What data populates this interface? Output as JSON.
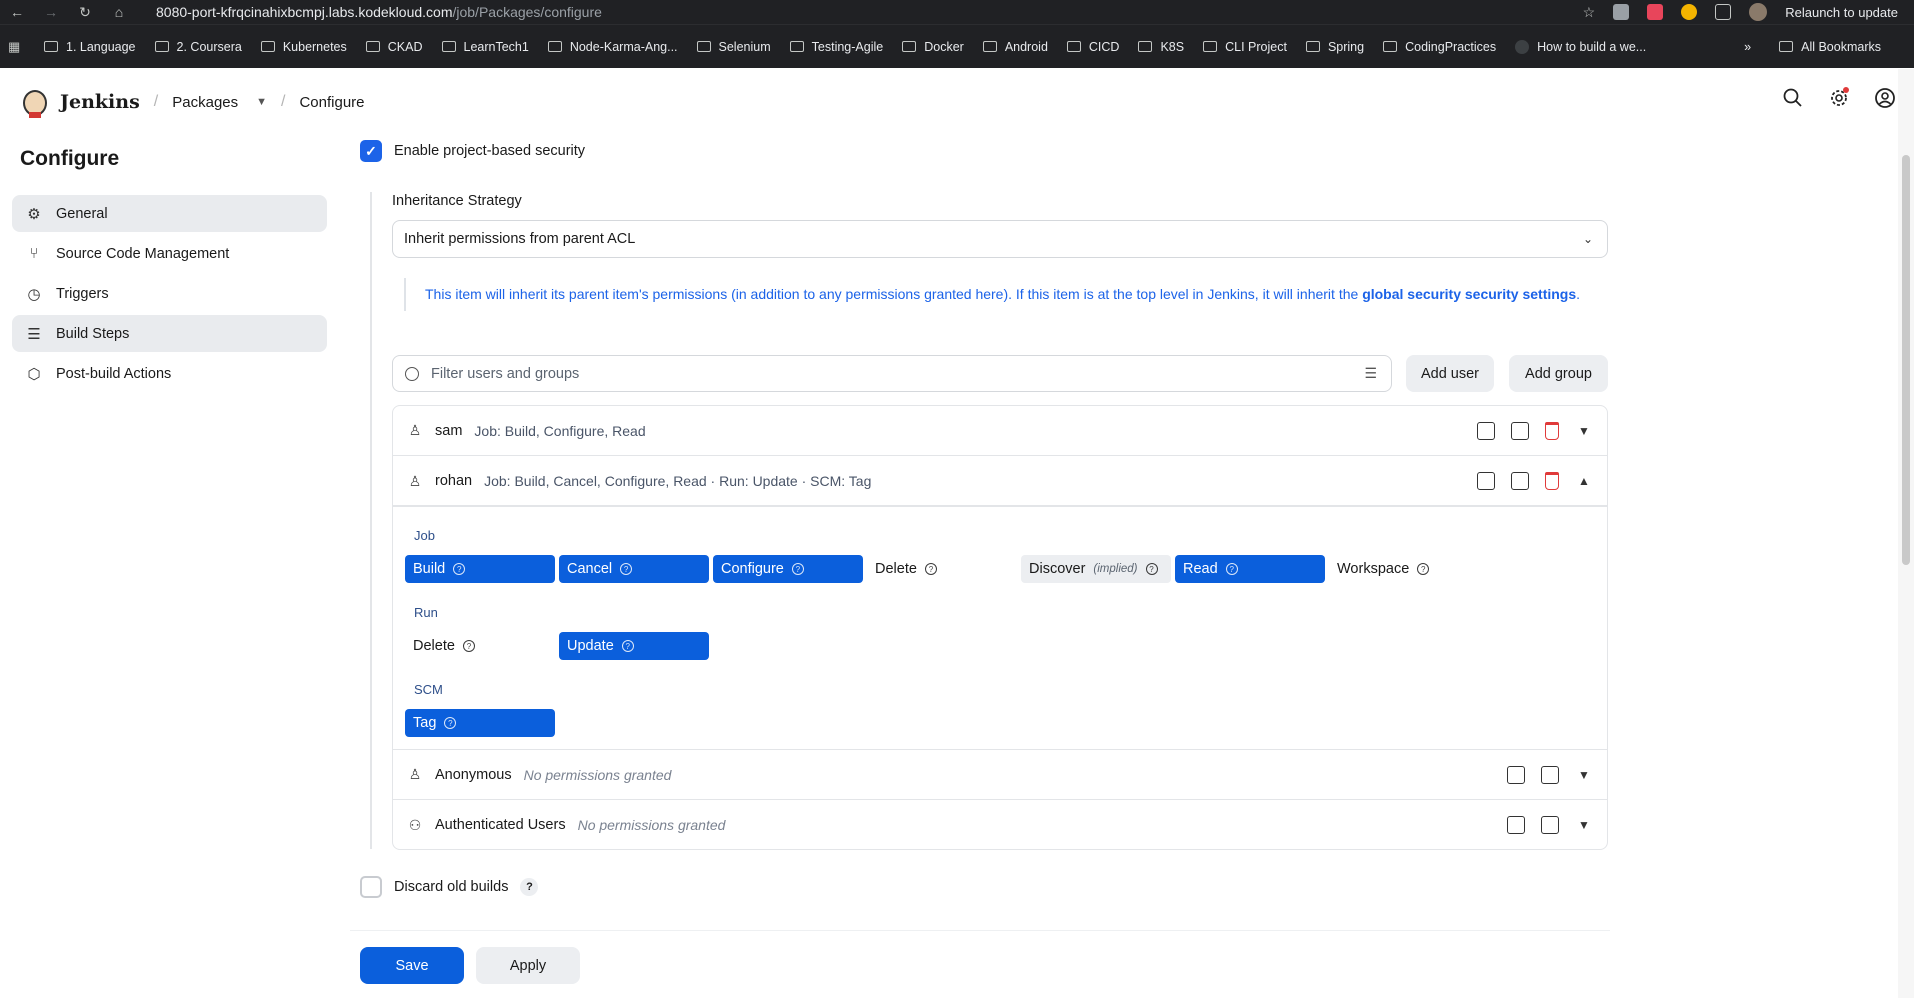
{
  "browser": {
    "url_host": "8080-port-kfrqcinahixbcmpj.labs.kodekloud.com",
    "url_path": "/job/Packages/configure",
    "relaunch_label": "Relaunch to update",
    "bookmarks": [
      "1. Language",
      "2. Coursera",
      "Kubernetes",
      "CKAD",
      "LearnTech1",
      "Node-Karma-Ang...",
      "Selenium",
      "Testing-Agile",
      "Docker",
      "Android",
      "CICD",
      "K8S",
      "CLI Project",
      "Spring",
      "CodingPractices",
      "How to build a we..."
    ],
    "bookmarks_overflow": "»",
    "all_bookmarks": "All Bookmarks"
  },
  "header": {
    "app_title": "Jenkins",
    "breadcrumb_job": "Packages",
    "breadcrumb_page": "Configure"
  },
  "sidebar": {
    "title": "Configure",
    "items": [
      {
        "label": "General",
        "icon": "gear-icon",
        "active": true
      },
      {
        "label": "Source Code Management",
        "icon": "branch-icon",
        "active": false
      },
      {
        "label": "Triggers",
        "icon": "clock-icon",
        "active": false
      },
      {
        "label": "Build Steps",
        "icon": "list-icon",
        "active": true
      },
      {
        "label": "Post-build Actions",
        "icon": "cube-icon",
        "active": false
      }
    ]
  },
  "security": {
    "enable_label": "Enable project-based security",
    "enabled": true,
    "inheritance_label": "Inheritance Strategy",
    "inheritance_value": "Inherit permissions from parent ACL",
    "help_text": "This item will inherit its parent item's permissions (in addition to any permissions granted here). If this item is at the top level in Jenkins, it will inherit the",
    "help_link": "global security security settings",
    "help_end": ".",
    "filter_placeholder": "Filter users and groups",
    "add_user_label": "Add user",
    "add_group_label": "Add group",
    "rows": [
      {
        "name": "sam",
        "summary": "Job: Build, Configure, Read",
        "expanded": false
      },
      {
        "name": "rohan",
        "summary": "Job: Build, Cancel, Configure, Read · Run: Update · SCM: Tag",
        "expanded": true
      },
      {
        "name": "Anonymous",
        "summary": "No permissions granted",
        "expanded": false
      },
      {
        "name": "Authenticated Users",
        "summary": "No permissions granted",
        "expanded": false
      }
    ],
    "detail": {
      "job_label": "Job",
      "job_perms": [
        {
          "label": "Build",
          "state": "on"
        },
        {
          "label": "Cancel",
          "state": "on"
        },
        {
          "label": "Configure",
          "state": "on"
        },
        {
          "label": "Delete",
          "state": "off"
        },
        {
          "label": "Discover",
          "state": "implied"
        },
        {
          "label": "Read",
          "state": "on"
        },
        {
          "label": "Workspace",
          "state": "off"
        }
      ],
      "implied_label": "(implied)",
      "run_label": "Run",
      "run_perms": [
        {
          "label": "Delete",
          "state": "off"
        },
        {
          "label": "Update",
          "state": "on"
        }
      ],
      "scm_label": "SCM",
      "scm_perms": [
        {
          "label": "Tag",
          "state": "on"
        }
      ]
    }
  },
  "discard": {
    "label": "Discard old builds",
    "help": "?",
    "checked": false
  },
  "actions": {
    "save_label": "Save",
    "apply_label": "Apply"
  },
  "colors": {
    "accent": "#0b5fdc",
    "delete": "#e03a3a",
    "link": "#1c63e8"
  }
}
